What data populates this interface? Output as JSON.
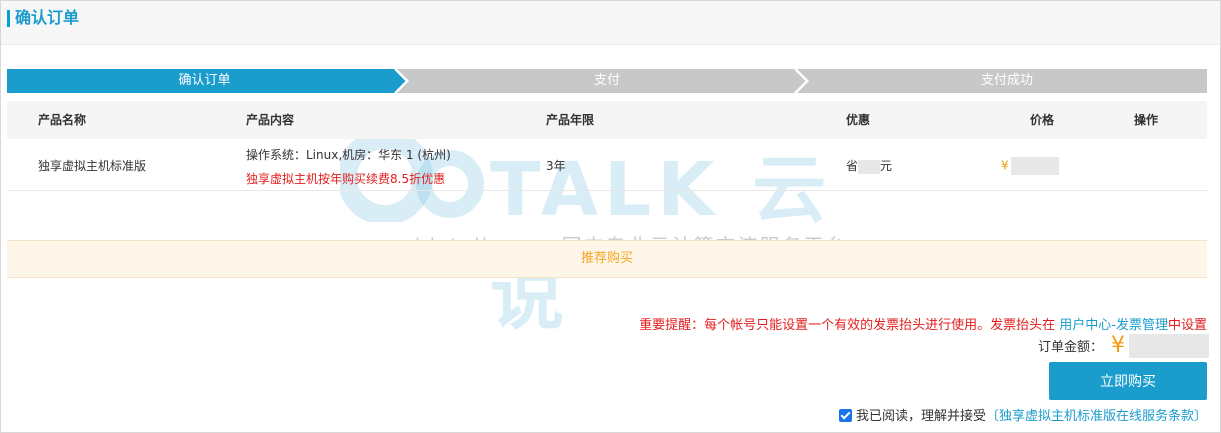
{
  "page": {
    "title": "确认订单"
  },
  "steps": [
    {
      "label": "确认订单",
      "active": true
    },
    {
      "label": "支付",
      "active": false
    },
    {
      "label": "支付成功",
      "active": false
    }
  ],
  "table": {
    "columns": [
      "产品名称",
      "产品内容",
      "产品年限",
      "优惠",
      "价格",
      "操作"
    ],
    "rows": [
      {
        "name": "独享虚拟主机标准版",
        "content": "操作系统：Linux,机房：华东 1 (杭州)",
        "promo": "独享虚拟主机按年购买续费8.5折优惠",
        "years": "3年",
        "discount_prefix": "省",
        "discount_suffix": "元",
        "price_symbol": "¥"
      }
    ]
  },
  "recommend": {
    "label": "推荐购买"
  },
  "watermark": {
    "brand": "TALK 云说",
    "tagline": "-www.idctalk.com-国内专业云计算交流服务平台-"
  },
  "notice": {
    "prefix": "重要提醒：每个帐号只能设置一个有效的发票抬头进行使用。发票抬头在 ",
    "link": "用户中心-发票管理",
    "suffix": "中设置"
  },
  "order": {
    "amount_label": "订单金额：",
    "currency": "¥"
  },
  "actions": {
    "buy_label": "立即购买"
  },
  "agreement": {
    "text": "我已阅读，理解并接受",
    "link": "〔独享虚拟主机标准版在线服务条款〕",
    "checked": true
  },
  "colors": {
    "accent": "#1a9ccc",
    "step_inactive": "#c8c8c8",
    "alert": "#e31d1d",
    "price": "#f39c12"
  }
}
